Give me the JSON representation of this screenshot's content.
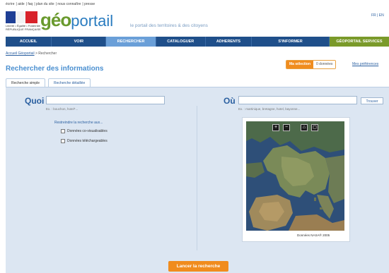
{
  "top_links": [
    "écrire",
    "aide",
    "faq",
    "plan du site",
    "nous connaître",
    "presse"
  ],
  "header": {
    "republic_text": "Liberté • Égalité • Fraternité RÉPUBLIQUE FRANÇAISE",
    "logo_geo": "géo",
    "logo_portail": "portail",
    "tagline": "le portail des territoires & des citoyens",
    "lang": "FR | EN"
  },
  "nav": {
    "items": [
      "ACCUEIL",
      "VOIR",
      "RECHERCHER",
      "CATALOGUER",
      "ADHERENTS",
      "S'INFORMER",
      "GÉOPORTAIL SERVICES"
    ],
    "active": "RECHERCHER"
  },
  "breadcrumb": {
    "home": "Accueil Géoportail",
    "sep": " > ",
    "current": "Rechercher"
  },
  "page_title": "Rechercher des informations",
  "selection": {
    "label": "Ma sélection",
    "count": "0 données"
  },
  "prefs_link": "Mes préférences",
  "tabs": [
    "Recherche simple",
    "Recherche détaillée"
  ],
  "search": {
    "quoi_label": "Quoi",
    "quoi_value": "",
    "quoi_hint": "Ex. : bouchon, hotel*...",
    "ou_label": "Où",
    "ou_value": "",
    "ou_hint": "Ex. : martinique, bretagne, hotel, bayonne...",
    "trouver_label": "Trouver",
    "restrict_label": "Restreindre la recherche aux...",
    "checkbox1": "Données co-visualisables",
    "checkbox2": "Données téléchargeables",
    "launch_label": "Lancer la recherche"
  },
  "map": {
    "credit": "Données NASA® 2005",
    "controls": [
      "zoom-in",
      "zoom-out",
      "home",
      "extent"
    ]
  },
  "colors": {
    "nav": "#1f4f8a",
    "nav_active": "#6a9fd8",
    "nav_services": "#7a9a2a",
    "accent_orange": "#f08c1e",
    "panel_bg": "#dce6f2",
    "title_blue": "#4a8fd0"
  }
}
